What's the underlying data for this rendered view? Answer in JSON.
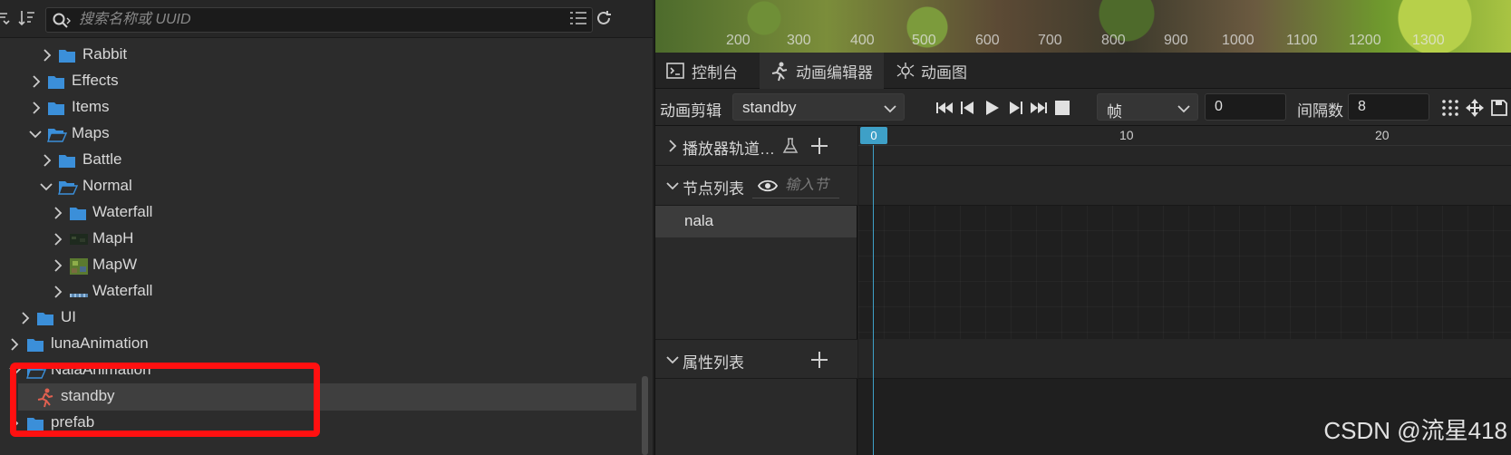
{
  "left_panel": {
    "search": {
      "placeholder": "搜索名称或 UUID",
      "value": ""
    },
    "tree": [
      {
        "label": "Rabbit",
        "type": "folder",
        "expanded": false
      },
      {
        "label": "Effects",
        "type": "folder",
        "expanded": false
      },
      {
        "label": "Items",
        "type": "folder",
        "expanded": false
      },
      {
        "label": "Maps",
        "type": "folder",
        "expanded": true
      },
      {
        "label": "Battle",
        "type": "folder",
        "expanded": false
      },
      {
        "label": "Normal",
        "type": "folder",
        "expanded": true
      },
      {
        "label": "Waterfall",
        "type": "folder",
        "expanded": false
      },
      {
        "label": "MapH",
        "type": "image",
        "expanded": false
      },
      {
        "label": "MapW",
        "type": "image",
        "expanded": false
      },
      {
        "label": "Waterfall",
        "type": "image",
        "expanded": false
      },
      {
        "label": "UI",
        "type": "folder",
        "expanded": false
      },
      {
        "label": "lunaAnimation",
        "type": "folder",
        "expanded": false
      },
      {
        "label": "NalaAnimation",
        "type": "folder",
        "expanded": true
      },
      {
        "label": "standby",
        "type": "animation-clip",
        "selected": true
      },
      {
        "label": "prefab",
        "type": "folder",
        "expanded": false
      }
    ]
  },
  "scene_ruler": [
    "200",
    "300",
    "400",
    "500",
    "600",
    "700",
    "800",
    "900",
    "1000",
    "1100",
    "1200",
    "1300"
  ],
  "tabs": [
    {
      "label": "控制台",
      "icon": "terminal-icon",
      "active": false
    },
    {
      "label": "动画编辑器",
      "icon": "running-figure-icon",
      "active": true
    },
    {
      "label": "动画图",
      "icon": "animation-graph-icon",
      "active": false
    }
  ],
  "toolbar": {
    "clip_label": "动画剪辑",
    "clip_value": "standby",
    "unit_value": "帧",
    "frame_value": "0",
    "interval_label": "间隔数",
    "interval_value": "8"
  },
  "sections": {
    "player_tracks": "播放器轨道…",
    "node_list": "节点列表",
    "node_filter_placeholder": "输入节",
    "node_item": "nala",
    "property_list": "属性列表"
  },
  "timeline": {
    "playhead": "0",
    "ticks": [
      "10",
      "20"
    ]
  },
  "watermark": "CSDN @流星418",
  "colors": {
    "accent": "#3ea0c7",
    "folder": "#3b8fd9",
    "annotation": "#ff1010",
    "clip_icon": "#e06050"
  }
}
